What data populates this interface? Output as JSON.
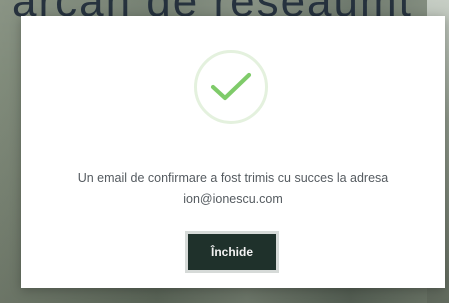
{
  "background": {
    "heading_fragment": "arcan de reseaumt"
  },
  "modal": {
    "icon": "check-icon",
    "message_line1": "Un email de confirmare a fost trimis cu succes la adresa",
    "email": "ion@ionescu.com",
    "close_label": "Închide",
    "accent_color": "#7fcb6a",
    "button_color": "#1f312b"
  }
}
